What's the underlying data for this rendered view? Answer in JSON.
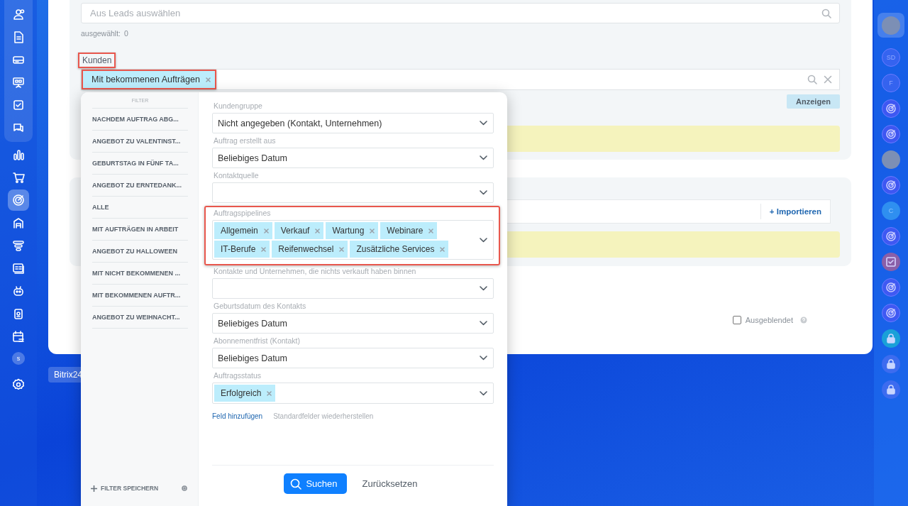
{
  "left_nav": {
    "items": [
      {
        "selected": false
      },
      {
        "selected": false
      },
      {
        "selected": false
      },
      {
        "selected": false
      },
      {
        "selected": false
      },
      {
        "selected": false
      },
      {
        "selected": false
      },
      {
        "selected": false
      },
      {
        "selected": true
      },
      {
        "selected": false
      },
      {
        "selected": false
      },
      {
        "selected": false
      },
      {
        "selected": false
      },
      {
        "selected": false
      },
      {
        "selected": false
      }
    ],
    "user_initial": "s"
  },
  "leads_search": {
    "placeholder": "Aus Leads auswählen"
  },
  "selected_count": {
    "label": "ausgewählt:",
    "value": "0"
  },
  "customers": {
    "label": "Kunden",
    "highlighted": true,
    "tags": [
      {
        "text": "Mit bekommenen Aufträgen",
        "highlighted": true
      }
    ],
    "show_button": "Anzeigen"
  },
  "import_button": "+ Importieren",
  "hidden_checkbox": {
    "label": "Ausgeblendet",
    "checked": false
  },
  "bottom_chip": "Bitrix24",
  "right_rail": [
    {
      "kind": "photo",
      "selected": true
    },
    {
      "kind": "initials",
      "text": "SD",
      "selected": false
    },
    {
      "kind": "initials",
      "text": "F",
      "selected": false
    },
    {
      "kind": "app",
      "selected": false
    },
    {
      "kind": "app",
      "selected": false
    },
    {
      "kind": "photo",
      "selected": false
    },
    {
      "kind": "app",
      "selected": false
    },
    {
      "kind": "letter",
      "text": "C",
      "selected": false
    },
    {
      "kind": "app",
      "selected": false
    },
    {
      "kind": "task",
      "selected": false
    },
    {
      "kind": "app",
      "selected": false
    },
    {
      "kind": "app",
      "selected": false
    },
    {
      "kind": "lock",
      "selected": false
    },
    {
      "kind": "lock",
      "selected": false
    },
    {
      "kind": "lock",
      "selected": false
    }
  ],
  "filter_popup": {
    "presets_heading": "FILTER",
    "presets": [
      {
        "label": "NACHDEM AUFTRAG ABG...",
        "selected": false
      },
      {
        "label": "ANGEBOT ZU VALENTINST...",
        "selected": false
      },
      {
        "label": "GEBURTSTAG IN FÜNF TA...",
        "selected": false
      },
      {
        "label": "ANGEBOT ZU ERNTEDANK...",
        "selected": false
      },
      {
        "label": "ALLE",
        "selected": false
      },
      {
        "label": "MIT AUFTRÄGEN IN ARBEIT",
        "selected": false
      },
      {
        "label": "ANGEBOT ZU HALLOWEEN",
        "selected": false
      },
      {
        "label": "MIT NICHT BEKOMMENEN ...",
        "selected": false
      },
      {
        "label": "MIT BEKOMMENEN AUFTR...",
        "selected": false
      },
      {
        "label": "ANGEBOT ZU WEIHNACHT...",
        "selected": false
      }
    ],
    "save_filter": "FILTER SPEICHERN",
    "fields": [
      {
        "kind": "select",
        "label": "Kundengruppe",
        "value": "Nicht angegeben (Kontakt, Unternehmen)",
        "highlighted": false
      },
      {
        "kind": "select",
        "label": "Auftrag erstellt aus",
        "value": "Beliebiges Datum",
        "highlighted": false
      },
      {
        "kind": "select",
        "label": "Kontaktquelle",
        "highlighted": false
      },
      {
        "kind": "tags",
        "label": "Auftragspipelines",
        "tags": [
          "Allgemein",
          "Verkauf",
          "Wartung",
          "Webinare",
          "IT-Berufe",
          "Reifenwechsel",
          "Zusätzliche Services"
        ],
        "highlighted": true
      },
      {
        "kind": "select",
        "label": "Kontakte und Unternehmen, die nichts verkauft haben binnen",
        "highlighted": false
      },
      {
        "kind": "select",
        "label": "Geburtsdatum des Kontakts",
        "value": "Beliebiges Datum",
        "highlighted": false
      },
      {
        "kind": "select",
        "label": "Abonnementfrist (Kontakt)",
        "value": "Beliebiges Datum",
        "highlighted": false
      },
      {
        "kind": "tags",
        "label": "Auftragsstatus",
        "tags": [
          "Erfolgreich"
        ],
        "highlighted": false
      }
    ],
    "add_field_link": "Feld hinzufügen",
    "restore_link": "Standardfelder wiederherstellen",
    "search_button": "Suchen",
    "reset_button": "Zurücksetzen"
  }
}
